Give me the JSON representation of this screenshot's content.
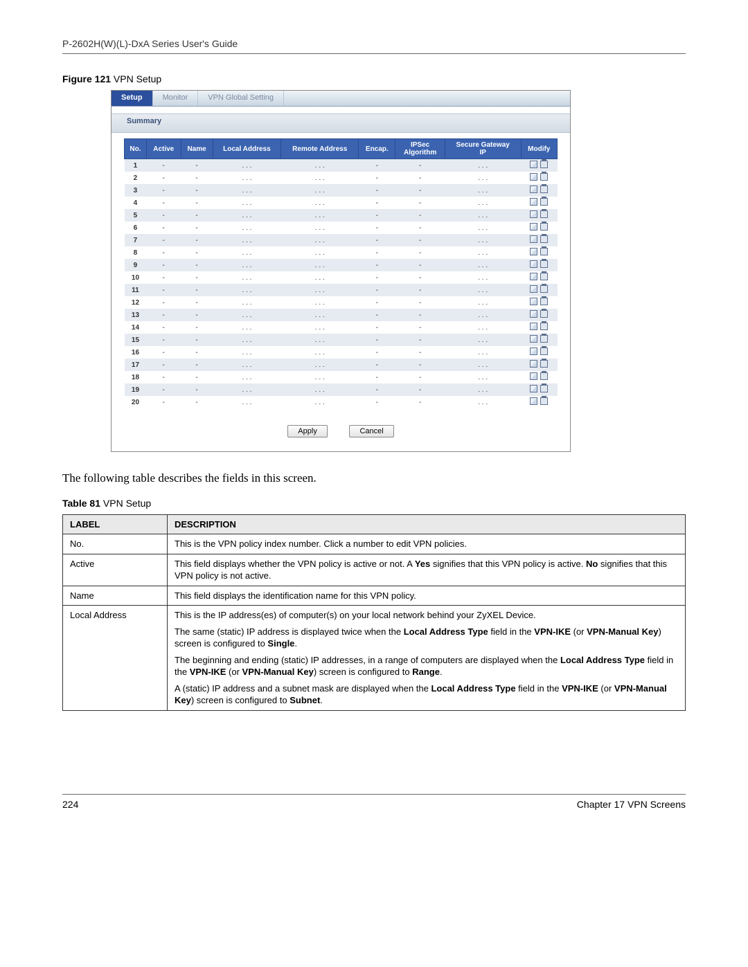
{
  "header_text": "P-2602H(W)(L)-DxA Series User's Guide",
  "figure_caption": {
    "prefix": "Figure 121",
    "suffix": "   VPN Setup"
  },
  "tabs": [
    {
      "label": "Setup",
      "active": true
    },
    {
      "label": "Monitor",
      "active": false
    },
    {
      "label": "VPN Global Setting",
      "active": false
    }
  ],
  "summary_title": "Summary",
  "vpn_columns": [
    "No.",
    "Active",
    "Name",
    "Local Address",
    "Remote Address",
    "Encap.",
    "IPSec\nAlgorithm",
    "Secure Gateway\nIP",
    "Modify"
  ],
  "vpn_rows": [
    {
      "no": "1",
      "active": "-",
      "name": "-",
      "local": ". . .",
      "remote": ". . .",
      "encap": "-",
      "ipsec": "-",
      "gw": ". . ."
    },
    {
      "no": "2",
      "active": "-",
      "name": "-",
      "local": ". . .",
      "remote": ". . .",
      "encap": "-",
      "ipsec": "-",
      "gw": ". . ."
    },
    {
      "no": "3",
      "active": "-",
      "name": "-",
      "local": ". . .",
      "remote": ". . .",
      "encap": "-",
      "ipsec": "-",
      "gw": ". . ."
    },
    {
      "no": "4",
      "active": "-",
      "name": "-",
      "local": ". . .",
      "remote": ". . .",
      "encap": "-",
      "ipsec": "-",
      "gw": ". . ."
    },
    {
      "no": "5",
      "active": "-",
      "name": "-",
      "local": ". . .",
      "remote": ". . .",
      "encap": "-",
      "ipsec": "-",
      "gw": ". . ."
    },
    {
      "no": "6",
      "active": "-",
      "name": "-",
      "local": ". . .",
      "remote": ". . .",
      "encap": "-",
      "ipsec": "-",
      "gw": ". . ."
    },
    {
      "no": "7",
      "active": "-",
      "name": "-",
      "local": ". . .",
      "remote": ". . .",
      "encap": "-",
      "ipsec": "-",
      "gw": ". . ."
    },
    {
      "no": "8",
      "active": "-",
      "name": "-",
      "local": ". . .",
      "remote": ". . .",
      "encap": "-",
      "ipsec": "-",
      "gw": ". . ."
    },
    {
      "no": "9",
      "active": "-",
      "name": "-",
      "local": ". . .",
      "remote": ". . .",
      "encap": "-",
      "ipsec": "-",
      "gw": ". . ."
    },
    {
      "no": "10",
      "active": "-",
      "name": "-",
      "local": ". . .",
      "remote": ". . .",
      "encap": "-",
      "ipsec": "-",
      "gw": ". . ."
    },
    {
      "no": "11",
      "active": "-",
      "name": "-",
      "local": ". . .",
      "remote": ". . .",
      "encap": "-",
      "ipsec": "-",
      "gw": ". . ."
    },
    {
      "no": "12",
      "active": "-",
      "name": "-",
      "local": ". . .",
      "remote": ". . .",
      "encap": "-",
      "ipsec": "-",
      "gw": ". . ."
    },
    {
      "no": "13",
      "active": "-",
      "name": "-",
      "local": ". . .",
      "remote": ". . .",
      "encap": "-",
      "ipsec": "-",
      "gw": ". . ."
    },
    {
      "no": "14",
      "active": "-",
      "name": "-",
      "local": ". . .",
      "remote": ". . .",
      "encap": "-",
      "ipsec": "-",
      "gw": ". . ."
    },
    {
      "no": "15",
      "active": "-",
      "name": "-",
      "local": ". . .",
      "remote": ". . .",
      "encap": "-",
      "ipsec": "-",
      "gw": ". . ."
    },
    {
      "no": "16",
      "active": "-",
      "name": "-",
      "local": ". . .",
      "remote": ". . .",
      "encap": "-",
      "ipsec": "-",
      "gw": ". . ."
    },
    {
      "no": "17",
      "active": "-",
      "name": "-",
      "local": ". . .",
      "remote": ". . .",
      "encap": "-",
      "ipsec": "-",
      "gw": ". . ."
    },
    {
      "no": "18",
      "active": "-",
      "name": "-",
      "local": ". . .",
      "remote": ". . .",
      "encap": "-",
      "ipsec": "-",
      "gw": ". . ."
    },
    {
      "no": "19",
      "active": "-",
      "name": "-",
      "local": ". . .",
      "remote": ". . .",
      "encap": "-",
      "ipsec": "-",
      "gw": ". . ."
    },
    {
      "no": "20",
      "active": "-",
      "name": "-",
      "local": ". . .",
      "remote": ". . .",
      "encap": "-",
      "ipsec": "-",
      "gw": ". . ."
    }
  ],
  "buttons": {
    "apply": "Apply",
    "cancel": "Cancel"
  },
  "body_text": "The following table describes the fields in this screen.",
  "table_caption": {
    "prefix": "Table 81",
    "suffix": "   VPN Setup"
  },
  "desc_columns": [
    "LABEL",
    "DESCRIPTION"
  ],
  "desc_rows": [
    {
      "label": "No.",
      "html": "This is the VPN policy index number. Click a number to edit VPN policies."
    },
    {
      "label": "Active",
      "html": "This field displays whether the VPN policy is active or not. A <b>Yes</b> signifies that this VPN policy is active. <b>No</b> signifies that this VPN policy is not active."
    },
    {
      "label": "Name",
      "html": "This field displays the identification name for this VPN policy."
    },
    {
      "label": "Local Address",
      "html": "This is the IP address(es) of computer(s) on your local network behind your ZyXEL Device.<span class='para-gap'></span>The same (static) IP address is displayed twice when the <b>Local Address Type</b> field in the <b>VPN-IKE</b> (or <b>VPN-Manual Key</b>) screen is configured to <b>Single</b>.<span class='para-gap'></span>The beginning and ending (static) IP addresses, in a range of computers are displayed when the <b>Local Address Type</b> field in the <b>VPN-IKE</b> (or <b>VPN-Manual Key</b>) screen is configured to <b>Range</b>.<span class='para-gap'></span>A (static) IP address and a subnet mask are displayed when the <b>Local Address Type</b> field in the <b>VPN-IKE</b> (or <b>VPN-Manual Key</b>) screen is configured to <b>Subnet</b>."
    }
  ],
  "footer": {
    "page_no": "224",
    "chapter": "Chapter 17 VPN Screens"
  }
}
